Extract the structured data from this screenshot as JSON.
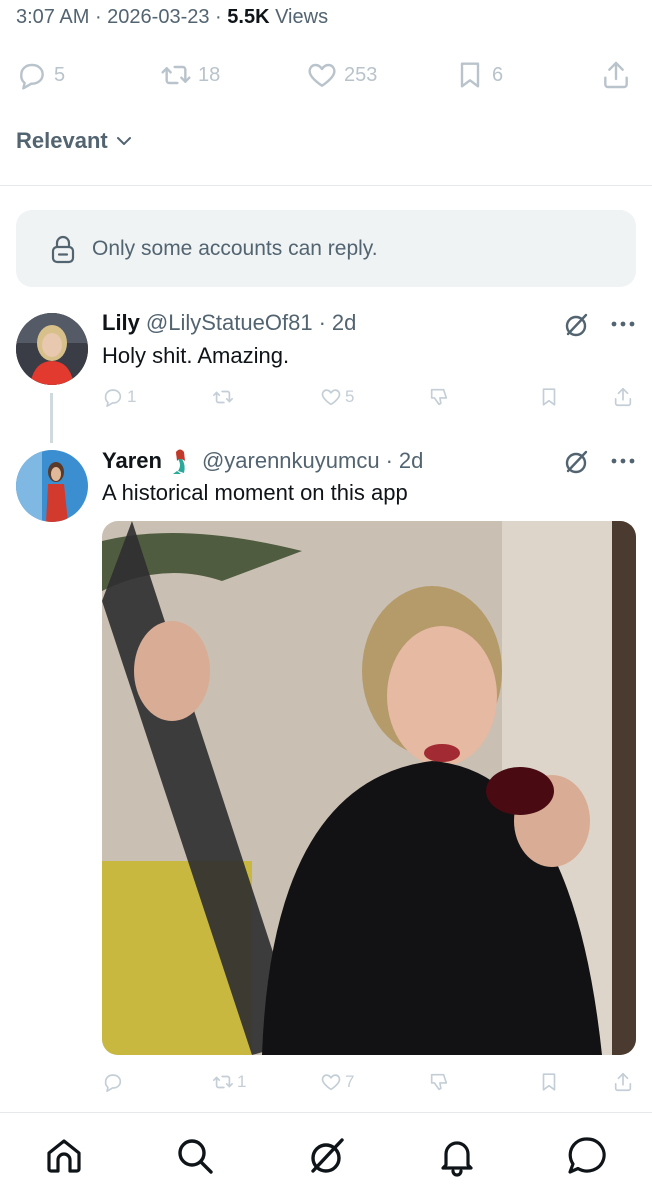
{
  "tweet_meta": {
    "time": "3:07 AM",
    "date": "2026-03-23",
    "views_count": "5.5K",
    "views_label": "Views"
  },
  "stats": {
    "replies": "5",
    "reposts": "18",
    "likes": "253",
    "bookmarks": "6"
  },
  "sort": {
    "label": "Relevant"
  },
  "reply_notice": {
    "text": "Only some accounts can reply."
  },
  "replies": [
    {
      "name": "Lily",
      "handle": "@LilyStatueOf81",
      "age": "2d",
      "text": "Holy shit. Amazing.",
      "reply_count": "1",
      "repost_count": "",
      "like_count": "5",
      "avatar_colors": {
        "bg": "#3a3d46",
        "hair": "#d8c08a",
        "dress": "#e23a2e"
      }
    },
    {
      "name": "Yaren",
      "handle": "@yarennkuyumcu",
      "age": "2d",
      "text": "A historical moment on this app",
      "reply_count": "",
      "repost_count": "1",
      "like_count": "7",
      "avatar_colors": {
        "bg": "#3b8fd0",
        "hair": "#5a3a2a",
        "dress": "#d23a2e"
      }
    }
  ],
  "colors": {
    "text_primary": "#0f1419",
    "text_secondary": "#536471",
    "icon_muted": "#c4ced6",
    "notice_bg": "#eff3f4"
  },
  "icons": {
    "reply": "reply-icon",
    "repost": "repost-icon",
    "like": "heart-icon",
    "bookmark": "bookmark-icon",
    "share": "share-icon",
    "grok": "grok-icon",
    "more": "more-dots-icon",
    "lock": "lock-icon",
    "dislike": "thumbs-down-icon"
  },
  "bottom_nav": [
    "home-icon",
    "search-icon",
    "grok-icon",
    "notifications-icon",
    "messages-icon"
  ]
}
